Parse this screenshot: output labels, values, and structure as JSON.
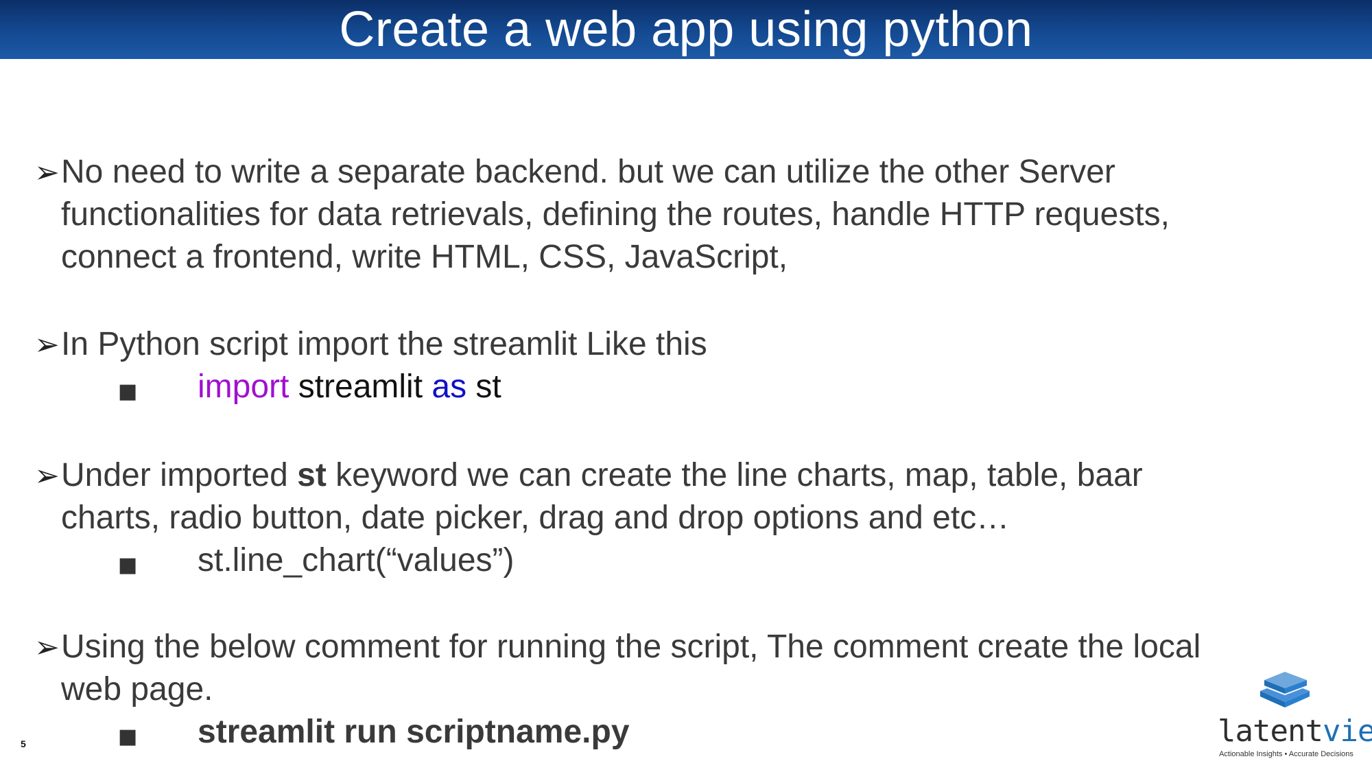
{
  "slide": {
    "title": "Create a web app using python",
    "page_number": "5"
  },
  "bullets": [
    {
      "lines": [
        "No need to write a separate backend. but we can utilize the other Server",
        "functionalities for data retrievals, defining the routes, handle HTTP requests,",
        "connect a frontend, write HTML, CSS, JavaScript,"
      ]
    },
    {
      "lines": [
        "In Python script import the streamlit Like this"
      ],
      "sub": {
        "kw_import": "import",
        "module": " streamlit ",
        "kw_as": "as",
        "alias": " st"
      }
    },
    {
      "line1_prefix": "Under imported ",
      "line1_bold": "st",
      "line1_suffix": " keyword we can create the line charts, map, table, baar",
      "line2": "charts, radio button, date picker, drag and drop options and etc…",
      "sub": "st.line_chart(“values”)"
    },
    {
      "lines": [
        "Using the below comment for running the script, The comment create the local",
        "web page."
      ],
      "sub": "streamlit run scriptname.py"
    }
  ],
  "logo": {
    "word_a": "latent",
    "word_b": "view",
    "tagline": "Actionable Insights • Accurate Decisions"
  },
  "icons": {
    "bullet": "arrowhead-bullet-icon",
    "sub_bullet": "square-bullet-icon",
    "logo": "stacked-layers-logo-icon"
  },
  "colors": {
    "title_bar": "#144a92",
    "body_text": "#3a3a3a",
    "keyword_import": "#a010d0",
    "keyword_as": "#1010c8",
    "logo_blue": "#1f6fb5"
  }
}
